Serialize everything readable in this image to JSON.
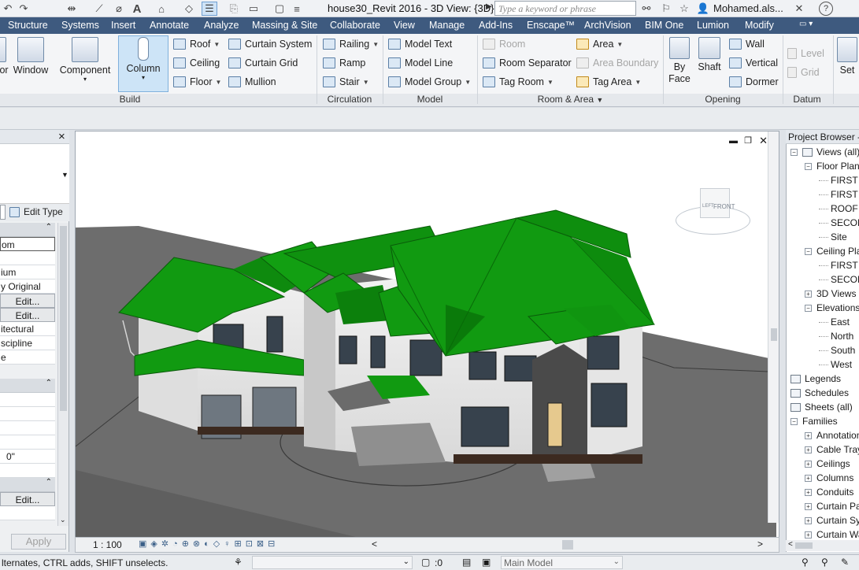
{
  "titlebar": {
    "doc_title": "house30_Revit 2016 - 3D View: {3D}",
    "search_placeholder": "Type a keyword or phrase",
    "user": "Mohamed.als...",
    "help": "?"
  },
  "menu": [
    "Structure",
    "Systems",
    "Insert",
    "Annotate",
    "Analyze",
    "Massing & Site",
    "Collaborate",
    "View",
    "Manage",
    "Add-Ins",
    "Enscape™",
    "ArchVision",
    "BIM One",
    "Lumion",
    "Modify"
  ],
  "ribbon": {
    "build": {
      "title": "Build",
      "big": [
        "or",
        "Window",
        "Component",
        "Column"
      ],
      "small_col1": [
        "Roof",
        "Ceiling",
        "Floor"
      ],
      "small_col2": [
        "Curtain System",
        "Curtain Grid",
        "Mullion"
      ]
    },
    "circulation": {
      "title": "Circulation",
      "items": [
        "Railing",
        "Ramp",
        "Stair"
      ]
    },
    "model": {
      "title": "Model",
      "items": [
        "Model Text",
        "Model Line",
        "Model Group"
      ]
    },
    "room_area": {
      "title": "Room & Area",
      "col1": [
        "Room",
        "Room  Separator",
        "Tag  Room"
      ],
      "col2": [
        "Area",
        "Area  Boundary",
        "Tag  Area"
      ]
    },
    "opening": {
      "title": "Opening",
      "big": [
        "By Face",
        "Shaft"
      ],
      "small": [
        "Wall",
        "Vertical",
        "Dormer"
      ]
    },
    "datum": {
      "title": "Datum",
      "items": [
        "Level",
        "Grid"
      ],
      "set": "Set"
    }
  },
  "properties": {
    "close": "×",
    "edit_type": "Edit Type",
    "rows": [
      "om",
      "",
      "ium",
      "y Original",
      "Edit...",
      "Edit...",
      "itectural",
      "scipline",
      "e"
    ],
    "section_arrow": "⌃",
    "val_0": "0\"",
    "edit3": "Edit...",
    "apply": "Apply"
  },
  "view": {
    "scale": "1 : 100",
    "viewcube": "FRONT",
    "viewcube_left": "LEFT"
  },
  "browser": {
    "title": "Project Browser - ",
    "items": [
      {
        "label": "Views (all)",
        "level": 0,
        "box": "−"
      },
      {
        "label": "Floor Plans",
        "level": 1,
        "box": "−"
      },
      {
        "label": "FIRST",
        "level": 2
      },
      {
        "label": "FIRST",
        "level": 2
      },
      {
        "label": "ROOF",
        "level": 2
      },
      {
        "label": "SECOND",
        "level": 2
      },
      {
        "label": "Site",
        "level": 2
      },
      {
        "label": "Ceiling Plans",
        "level": 1,
        "box": "−"
      },
      {
        "label": "FIRST",
        "level": 2
      },
      {
        "label": "SECOND",
        "level": 2
      },
      {
        "label": "3D Views",
        "level": 1,
        "box": "+"
      },
      {
        "label": "Elevations",
        "level": 1,
        "box": "−"
      },
      {
        "label": "East",
        "level": 2
      },
      {
        "label": "North",
        "level": 2
      },
      {
        "label": "South",
        "level": 2
      },
      {
        "label": "West",
        "level": 2
      },
      {
        "label": "Legends",
        "level": 0,
        "icon": true
      },
      {
        "label": "Schedules",
        "level": 0,
        "icon": true
      },
      {
        "label": "Sheets (all)",
        "level": 0,
        "icon": true
      },
      {
        "label": "Families",
        "level": 0,
        "box": "−"
      },
      {
        "label": "Annotation",
        "level": 1,
        "box": "+"
      },
      {
        "label": "Cable Tray",
        "level": 1,
        "box": "+"
      },
      {
        "label": "Ceilings",
        "level": 1,
        "box": "+"
      },
      {
        "label": "Columns",
        "level": 1,
        "box": "+"
      },
      {
        "label": "Conduits",
        "level": 1,
        "box": "+"
      },
      {
        "label": "Curtain Panels",
        "level": 1,
        "box": "+"
      },
      {
        "label": "Curtain Systems",
        "level": 1,
        "box": "+"
      },
      {
        "label": "Curtain Walls",
        "level": 1,
        "box": "+"
      }
    ]
  },
  "status": {
    "hint": "lternates, CTRL adds, SHIFT unselects.",
    "count": ":0",
    "model": "Main Model"
  },
  "colors": {
    "roof": "#119a11",
    "menu": "#3e5a7f",
    "ground": "#6b6b6b"
  }
}
